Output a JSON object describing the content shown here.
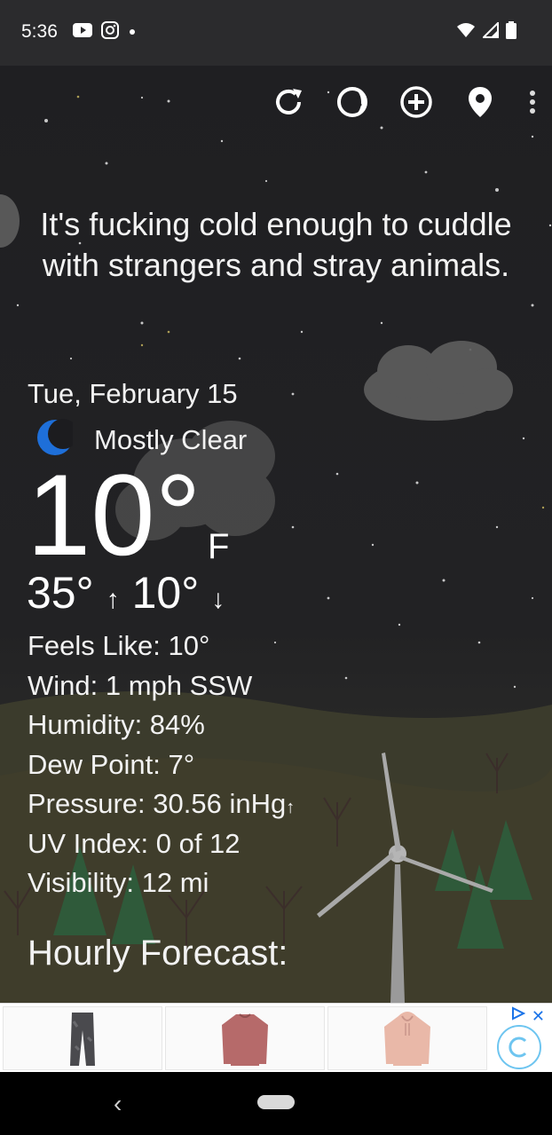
{
  "status_bar": {
    "time": "5:36",
    "left_icons": [
      "youtube-icon",
      "instagram-icon",
      "dot-icon"
    ],
    "right_icons": [
      "wifi-icon",
      "signal-icon",
      "battery-icon"
    ]
  },
  "toolbar": {
    "icons": [
      "refresh-icon",
      "moon-phase-icon",
      "add-location-icon",
      "location-pin-icon",
      "more-vert-icon"
    ]
  },
  "quote": "It's fucking cold enough to cuddle with strangers and stray animals.",
  "weather": {
    "date": "Tue, February 15",
    "condition": "Mostly Clear",
    "condition_icon": "crescent-moon-icon",
    "temperature": "10°",
    "unit": "F",
    "high": "35°",
    "low": "10°",
    "details": [
      "Feels Like:  10°",
      "Wind:  1 mph SSW",
      "Humidity:  84%",
      "Dew Point:  7°",
      "Pressure:  30.56 inHg",
      "UV Index:  0 of 12",
      "Visibility:  12 mi"
    ],
    "pressure_trend_icon": "arrow-up-small-icon"
  },
  "hourly_title": "Hourly Forecast:",
  "ad": {
    "products": [
      "joggers-product",
      "crewneck-sweatshirt-product",
      "hoodie-product"
    ],
    "close_label": "✕"
  },
  "colors": {
    "background": "#1c1c1f",
    "status_bar": "#2b2b2d",
    "moon_blue": "#1e6fd9",
    "text": "#f2f2f2"
  }
}
